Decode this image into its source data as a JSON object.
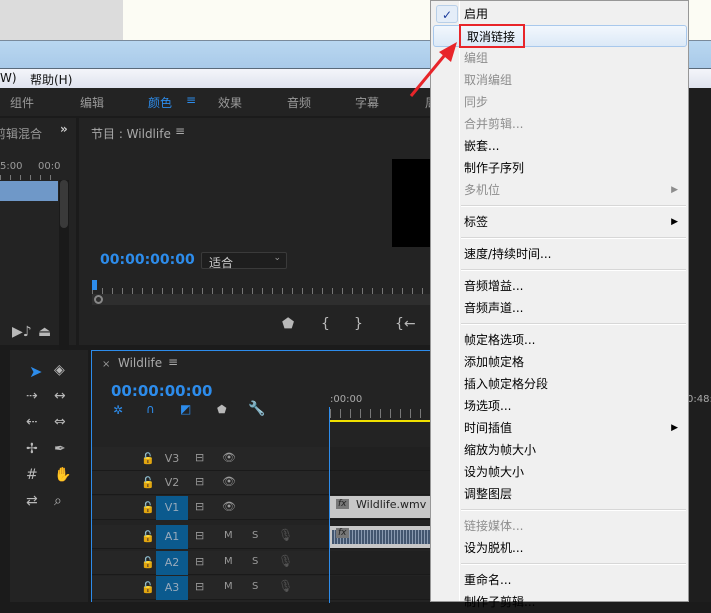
{
  "menubar": {
    "items": [
      "W)",
      "帮助(H)"
    ]
  },
  "workspaces": {
    "tabs": [
      "组件",
      "编辑",
      "颜色",
      "效果",
      "音频",
      "字幕",
      "周"
    ],
    "active": "颜色",
    "menu_icon": "≡"
  },
  "left_panel": {
    "title": "剪辑混合",
    "overflow": "»",
    "ticks": [
      "5:00",
      "00:0"
    ]
  },
  "program": {
    "title": "节目 : Wildlife",
    "timecode": "00:00:00:00",
    "fit": "适合"
  },
  "timeline": {
    "title": "Wildlife",
    "timecode": "00:00:00:00",
    "ruler": [
      ":00:00",
      "0:48:"
    ],
    "tracks": [
      {
        "name": "V3",
        "type": "video",
        "target": false
      },
      {
        "name": "V2",
        "type": "video",
        "target": false
      },
      {
        "name": "V1",
        "type": "video",
        "target": true
      },
      {
        "name": "A1",
        "type": "audio",
        "target": true
      },
      {
        "name": "A2",
        "type": "audio",
        "target": true
      },
      {
        "name": "A3",
        "type": "audio",
        "target": true
      }
    ],
    "mute": "M",
    "solo": "S",
    "clip_video": "Wildlife.wmv [V]",
    "fx": "fx"
  },
  "context_menu": {
    "items": [
      {
        "label": "启用",
        "checked": true
      },
      {
        "label": "取消链接",
        "highlighted": true
      },
      {
        "label": "编组",
        "disabled": true
      },
      {
        "label": "取消编组",
        "disabled": true
      },
      {
        "label": "同步",
        "disabled": true
      },
      {
        "label": "合并剪辑...",
        "disabled": true
      },
      {
        "label": "嵌套..."
      },
      {
        "label": "制作子序列"
      },
      {
        "label": "多机位",
        "disabled": true,
        "submenu": true
      },
      {
        "sep": true
      },
      {
        "label": "标签",
        "submenu": true
      },
      {
        "sep": true
      },
      {
        "label": "速度/持续时间..."
      },
      {
        "sep": true
      },
      {
        "label": "音频增益..."
      },
      {
        "label": "音频声道..."
      },
      {
        "sep": true
      },
      {
        "label": "帧定格选项..."
      },
      {
        "label": "添加帧定格"
      },
      {
        "label": "插入帧定格分段"
      },
      {
        "label": "场选项..."
      },
      {
        "label": "时间插值",
        "submenu": true
      },
      {
        "label": "缩放为帧大小"
      },
      {
        "label": "设为帧大小"
      },
      {
        "label": "调整图层"
      },
      {
        "sep": true
      },
      {
        "label": "链接媒体...",
        "disabled": true
      },
      {
        "label": "设为脱机..."
      },
      {
        "sep": true
      },
      {
        "label": "重命名..."
      },
      {
        "label": "制作子剪辑..."
      }
    ]
  },
  "colors": {
    "accent": "#2d8ceb",
    "annotation": "#e8252a",
    "highlight": "#dce9f7"
  }
}
